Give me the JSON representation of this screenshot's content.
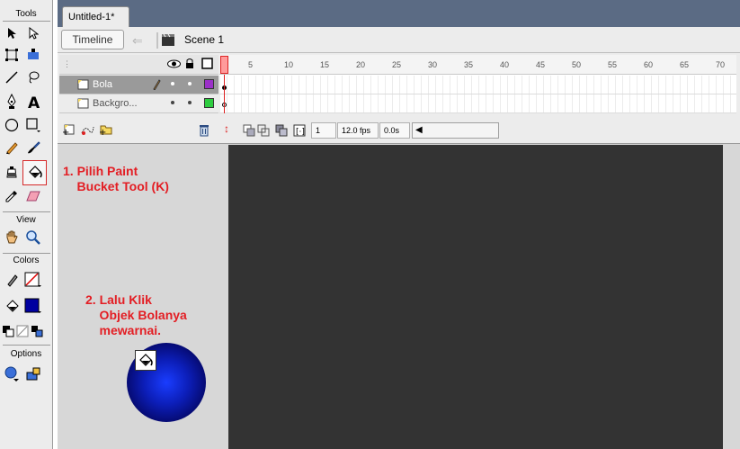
{
  "tools_panel": {
    "title": "Tools",
    "view_title": "View",
    "colors_title": "Colors",
    "options_title": "Options",
    "active_tool": "paint-bucket"
  },
  "document": {
    "tab_title": "Untitled-1*",
    "timeline_button": "Timeline",
    "scene_label": "Scene 1"
  },
  "timeline": {
    "frame_numbers": [
      "5",
      "10",
      "15",
      "20",
      "25",
      "30",
      "35",
      "40",
      "45",
      "50",
      "55",
      "60",
      "65",
      "70"
    ],
    "layers": [
      {
        "name": "Bola",
        "color": "#9b30c8",
        "selected": true
      },
      {
        "name": "Backgro...",
        "color": "#2ecc40",
        "selected": false
      }
    ],
    "current_frame": "1",
    "frame_rate": "12.0 fps",
    "elapsed": "0.0s"
  },
  "annotations": {
    "step1": "1. Pilih Paint\n    Bucket Tool (K)",
    "step2": "2. Lalu Klik\n    Objek Bolanya\n    mewarnai."
  },
  "colors": {
    "stroke": "#000000",
    "fill": "#0000a0",
    "stage_bg": "#333333",
    "ball": "#0c1eb8",
    "annotation": "#e31e24"
  }
}
